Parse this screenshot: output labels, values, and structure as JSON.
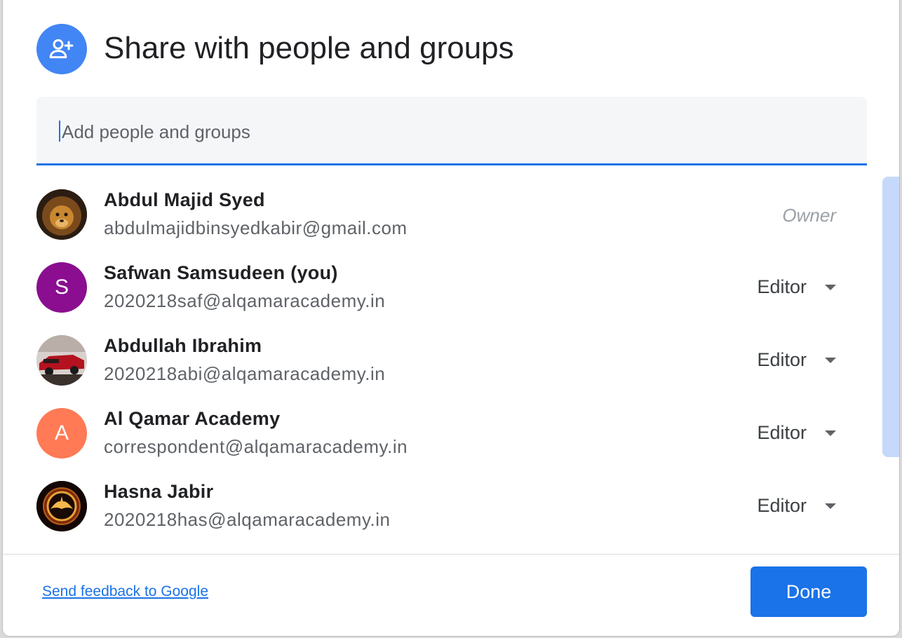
{
  "dialog": {
    "title": "Share with people and groups",
    "header_icon": "person-add-icon"
  },
  "search": {
    "placeholder": "Add people and groups",
    "value": ""
  },
  "people": [
    {
      "name": "Abdul Majid Syed",
      "email": "abdulmajidbinsyedkabir@gmail.com",
      "role": "Owner",
      "avatar": "photo-lion"
    },
    {
      "name": "Safwan Samsudeen (you)",
      "email": "2020218saf@alqamaracademy.in",
      "role": "Editor",
      "avatar_letter": "S",
      "avatar_color": "#8a0e8f"
    },
    {
      "name": "Abdullah Ibrahim",
      "email": "2020218abi@alqamaracademy.in",
      "role": "Editor",
      "avatar": "photo-car"
    },
    {
      "name": "Al Qamar Academy",
      "email": "correspondent@alqamaracademy.in",
      "role": "Editor",
      "avatar_letter": "A",
      "avatar_color": "#ff7a55"
    },
    {
      "name": "Hasna Jabir",
      "email": "2020218has@alqamaracademy.in",
      "role": "Editor",
      "avatar": "photo-mockingjay"
    }
  ],
  "footer": {
    "feedback_link": "Send feedback to Google",
    "done_label": "Done"
  },
  "colors": {
    "accent": "#1a73e8",
    "header_icon_bg": "#4285f4"
  }
}
